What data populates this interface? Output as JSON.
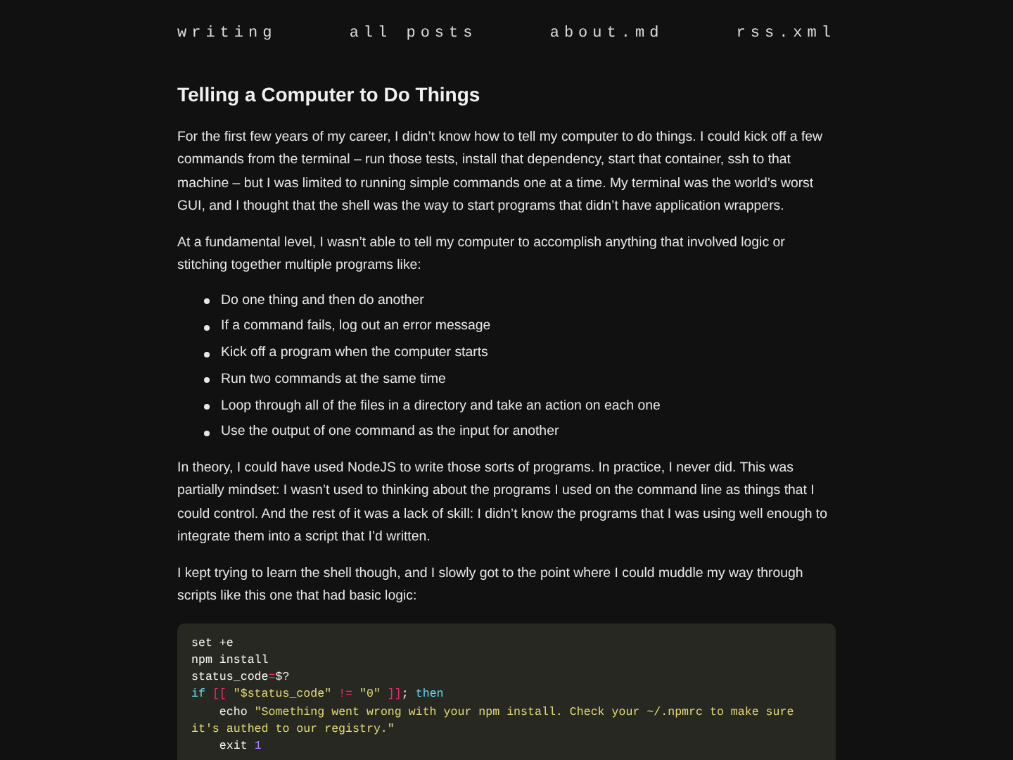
{
  "nav": [
    {
      "label": "writing"
    },
    {
      "label": "all posts"
    },
    {
      "label": "about.md"
    },
    {
      "label": "rss.xml"
    }
  ],
  "article": {
    "title": "Telling a Computer to Do Things",
    "blocks": [
      {
        "kind": "paragraph",
        "text": "For the first few years of my career, I didn’t know how to tell my computer to do things. I could kick off a few commands from the terminal – run those tests, install that dependency, start that container, ssh to that machine – but I was limited to running simple commands one at a time. My terminal was the world’s worst GUI, and I thought that the shell was the way to start programs that didn’t have application wrappers."
      },
      {
        "kind": "paragraph",
        "text": "At a fundamental level, I wasn’t able to tell my computer to accomplish anything that involved logic or stitching together multiple programs like:"
      },
      {
        "kind": "list",
        "items": [
          "Do one thing and then do another",
          "If a command fails, log out an error message",
          "Kick off a program when the computer starts",
          "Run two commands at the same time",
          "Loop through all of the files in a directory and take an action on each one",
          "Use the output of one command as the input for another"
        ]
      },
      {
        "kind": "paragraph",
        "text": "In theory, I could have used NodeJS to write those sorts of programs. In practice, I never did. This was partially mindset: I wasn’t used to thinking about the programs I used on the command line as things that I could control. And the rest of it was a lack of skill: I didn’t know the programs that I was using well enough to integrate them into a script that I’d written."
      },
      {
        "kind": "paragraph",
        "text": "I kept trying to learn the shell though, and I slowly got to the point where I could muddle my way through scripts like this one that had basic logic:"
      },
      {
        "kind": "code",
        "lines": [
          [
            {
              "kind": "plain",
              "text": "set +e"
            }
          ],
          [
            {
              "kind": "plain",
              "text": "npm install"
            }
          ],
          [
            {
              "kind": "plain",
              "text": "status_code"
            },
            {
              "kind": "operator",
              "text": "="
            },
            {
              "kind": "plain",
              "text": "$?"
            }
          ],
          [
            {
              "kind": "keyword",
              "text": "if "
            },
            {
              "kind": "operator",
              "text": "[[ "
            },
            {
              "kind": "string",
              "text": "\"$status_code\" "
            },
            {
              "kind": "operator",
              "text": "!= "
            },
            {
              "kind": "string",
              "text": "\"0\" "
            },
            {
              "kind": "operator",
              "text": "]]"
            },
            {
              "kind": "plain",
              "text": "; "
            },
            {
              "kind": "keyword",
              "text": "then"
            }
          ],
          [
            {
              "kind": "plain",
              "text": "    echo "
            },
            {
              "kind": "string",
              "text": "\"Something went wrong with your npm install. Check your ~/.npmrc to make sure it's authed to our registry.\""
            }
          ],
          [
            {
              "kind": "plain",
              "text": "    exit "
            },
            {
              "kind": "number",
              "text": "1"
            }
          ]
        ]
      }
    ]
  }
}
